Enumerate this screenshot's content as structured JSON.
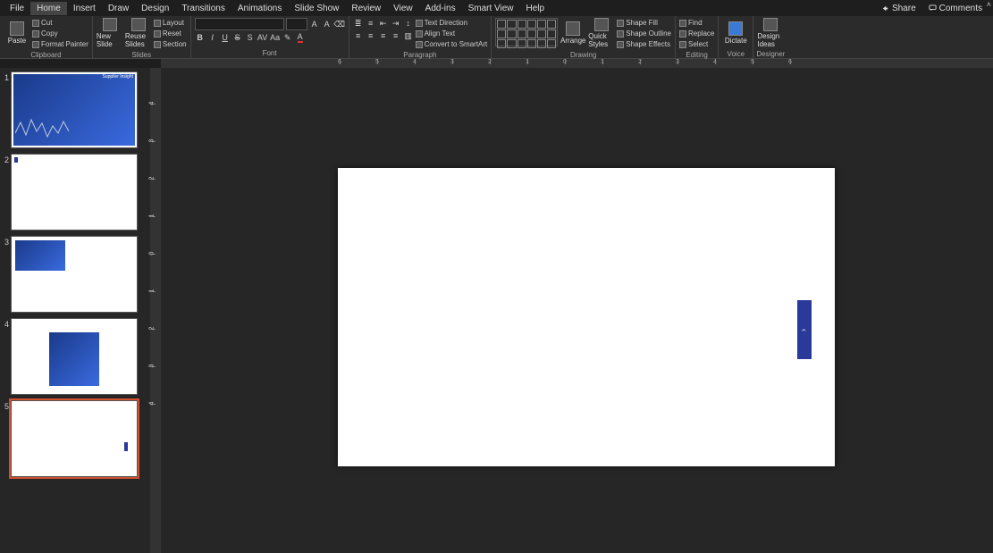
{
  "menubar": {
    "items": [
      "File",
      "Home",
      "Insert",
      "Draw",
      "Design",
      "Transitions",
      "Animations",
      "Slide Show",
      "Review",
      "View",
      "Add-ins",
      "Smart View",
      "Help"
    ],
    "active_index": 1,
    "share": "Share",
    "comments": "Comments"
  },
  "ribbon": {
    "clipboard": {
      "label": "Clipboard",
      "paste": "Paste",
      "cut": "Cut",
      "copy": "Copy",
      "format_painter": "Format Painter"
    },
    "slides": {
      "label": "Slides",
      "new_slide": "New Slide",
      "reuse_slides": "Reuse Slides",
      "layout": "Layout",
      "reset": "Reset",
      "section": "Section"
    },
    "font": {
      "label": "Font",
      "family": "",
      "size": "",
      "bold": "B",
      "italic": "I",
      "underline": "U",
      "strike": "S",
      "shadow": "S",
      "spacing": "AV",
      "case": "Aa"
    },
    "paragraph": {
      "label": "Paragraph",
      "text_direction": "Text Direction",
      "align_text": "Align Text",
      "convert_smartart": "Convert to SmartArt"
    },
    "drawing": {
      "label": "Drawing",
      "arrange": "Arrange",
      "quick_styles": "Quick Styles",
      "shape_fill": "Shape Fill",
      "shape_outline": "Shape Outline",
      "shape_effects": "Shape Effects"
    },
    "editing": {
      "label": "Editing",
      "find": "Find",
      "replace": "Replace",
      "select": "Select"
    },
    "voice": {
      "label": "Voice",
      "dictate": "Dictate"
    },
    "designer": {
      "label": "Designer",
      "design_ideas": "Design Ideas"
    }
  },
  "ruler_h_labels": [
    "6",
    "5",
    "4",
    "3",
    "2",
    "1",
    "0",
    "1",
    "2",
    "3",
    "4",
    "5",
    "6"
  ],
  "ruler_v_labels": [
    "4",
    "3",
    "2",
    "1",
    "0",
    "1",
    "2",
    "3",
    "4"
  ],
  "thumbnails": [
    {
      "n": "1",
      "kind": "full",
      "title_left": "",
      "title_right": "Supplier Insight"
    },
    {
      "n": "2",
      "kind": "blank_corner"
    },
    {
      "n": "3",
      "kind": "small_top"
    },
    {
      "n": "4",
      "kind": "mid_block"
    },
    {
      "n": "5",
      "kind": "tiny_mark",
      "selected": true
    }
  ],
  "slide_object_text": "‹"
}
